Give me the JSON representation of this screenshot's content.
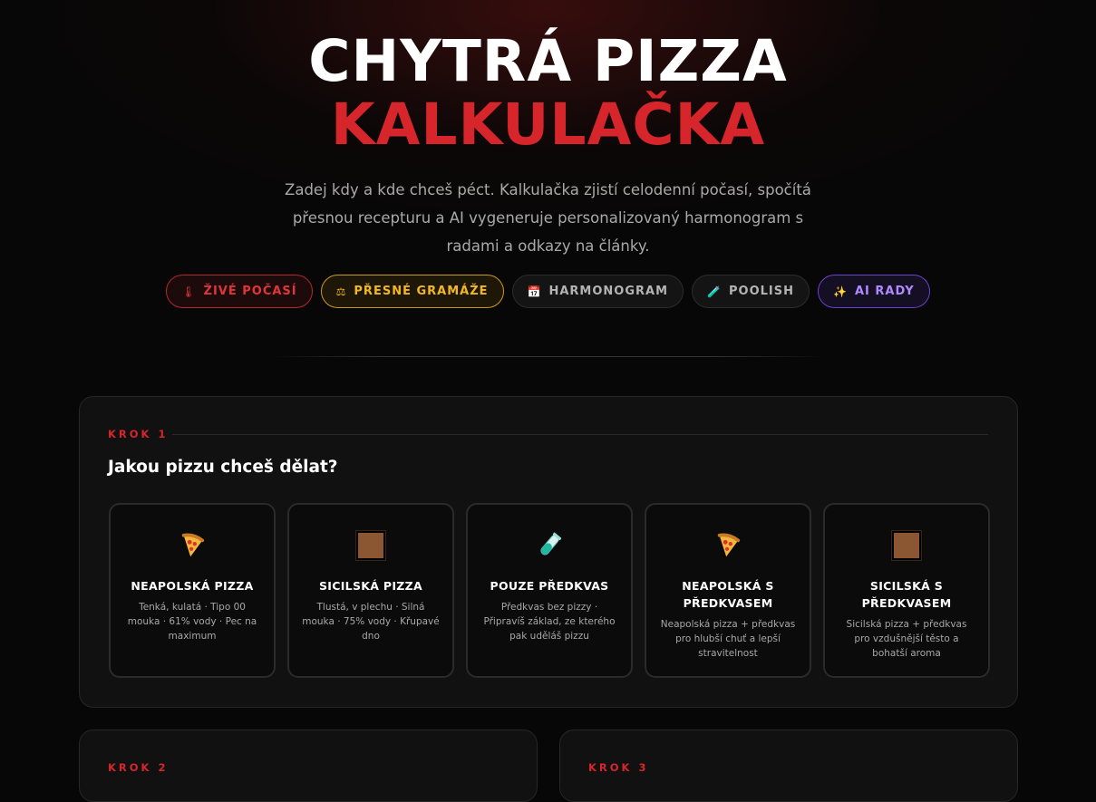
{
  "hero": {
    "title_line1": "CHYTRÁ PIZZA",
    "title_line2": "KALKULAČKA",
    "subtitle": "Zadej kdy a kde chceš péct. Kalkulačka zjistí celodenní počasí, spočítá přesnou recepturu a AI vygeneruje personalizovaný harmonogram s radami a odkazy na články."
  },
  "tags": [
    {
      "label": "ŽIVÉ POČASÍ",
      "icon": "thermometer-icon",
      "glyph": "🌡"
    },
    {
      "label": "PŘESNÉ GRAMÁŽE",
      "icon": "scale-icon",
      "glyph": "⚖"
    },
    {
      "label": "HARMONOGRAM",
      "icon": "calendar-icon",
      "glyph": "📅"
    },
    {
      "label": "POOLISH",
      "icon": "test-tube-icon",
      "glyph": "🧪"
    },
    {
      "label": "AI RADY",
      "icon": "sparkles-icon",
      "glyph": "✨"
    }
  ],
  "step1": {
    "label": "KROK 1",
    "question": "Jakou pizzu chceš dělat?",
    "options": [
      {
        "title": "NEAPOLSKÁ PIZZA",
        "desc": "Tenká, kulatá · Tipo 00 mouka · 61% vody · Pec na maximum",
        "icon": "pizza-slice-icon"
      },
      {
        "title": "SICILSKÁ PIZZA",
        "desc": "Tlustá, v plechu · Silná mouka · 75% vody · Křupavé dno",
        "icon": "square-pan-icon"
      },
      {
        "title": "POUZE PŘEDKVAS",
        "desc": "Předkvas bez pizzy · Připravíš základ, ze kterého pak uděláš pizzu",
        "icon": "test-tube-icon"
      },
      {
        "title": "NEAPOLSKÁ S PŘEDKVASEM",
        "desc": "Neapolská pizza + předkvas pro hlubší chuť a lepší stravitelnost",
        "icon": "pizza-slice-icon"
      },
      {
        "title": "SICILSKÁ S PŘEDKVASEM",
        "desc": "Sicilská pizza + předkvas pro vzdušnější těsto a bohatší aroma",
        "icon": "square-pan-icon"
      }
    ]
  },
  "step2": {
    "label": "KROK 2"
  },
  "step3": {
    "label": "KROK 3"
  },
  "colors": {
    "accent_red": "#d6262b",
    "accent_yellow": "#f2b81f",
    "accent_purple": "#b08aff",
    "background": "#070707",
    "card": "#111111"
  }
}
